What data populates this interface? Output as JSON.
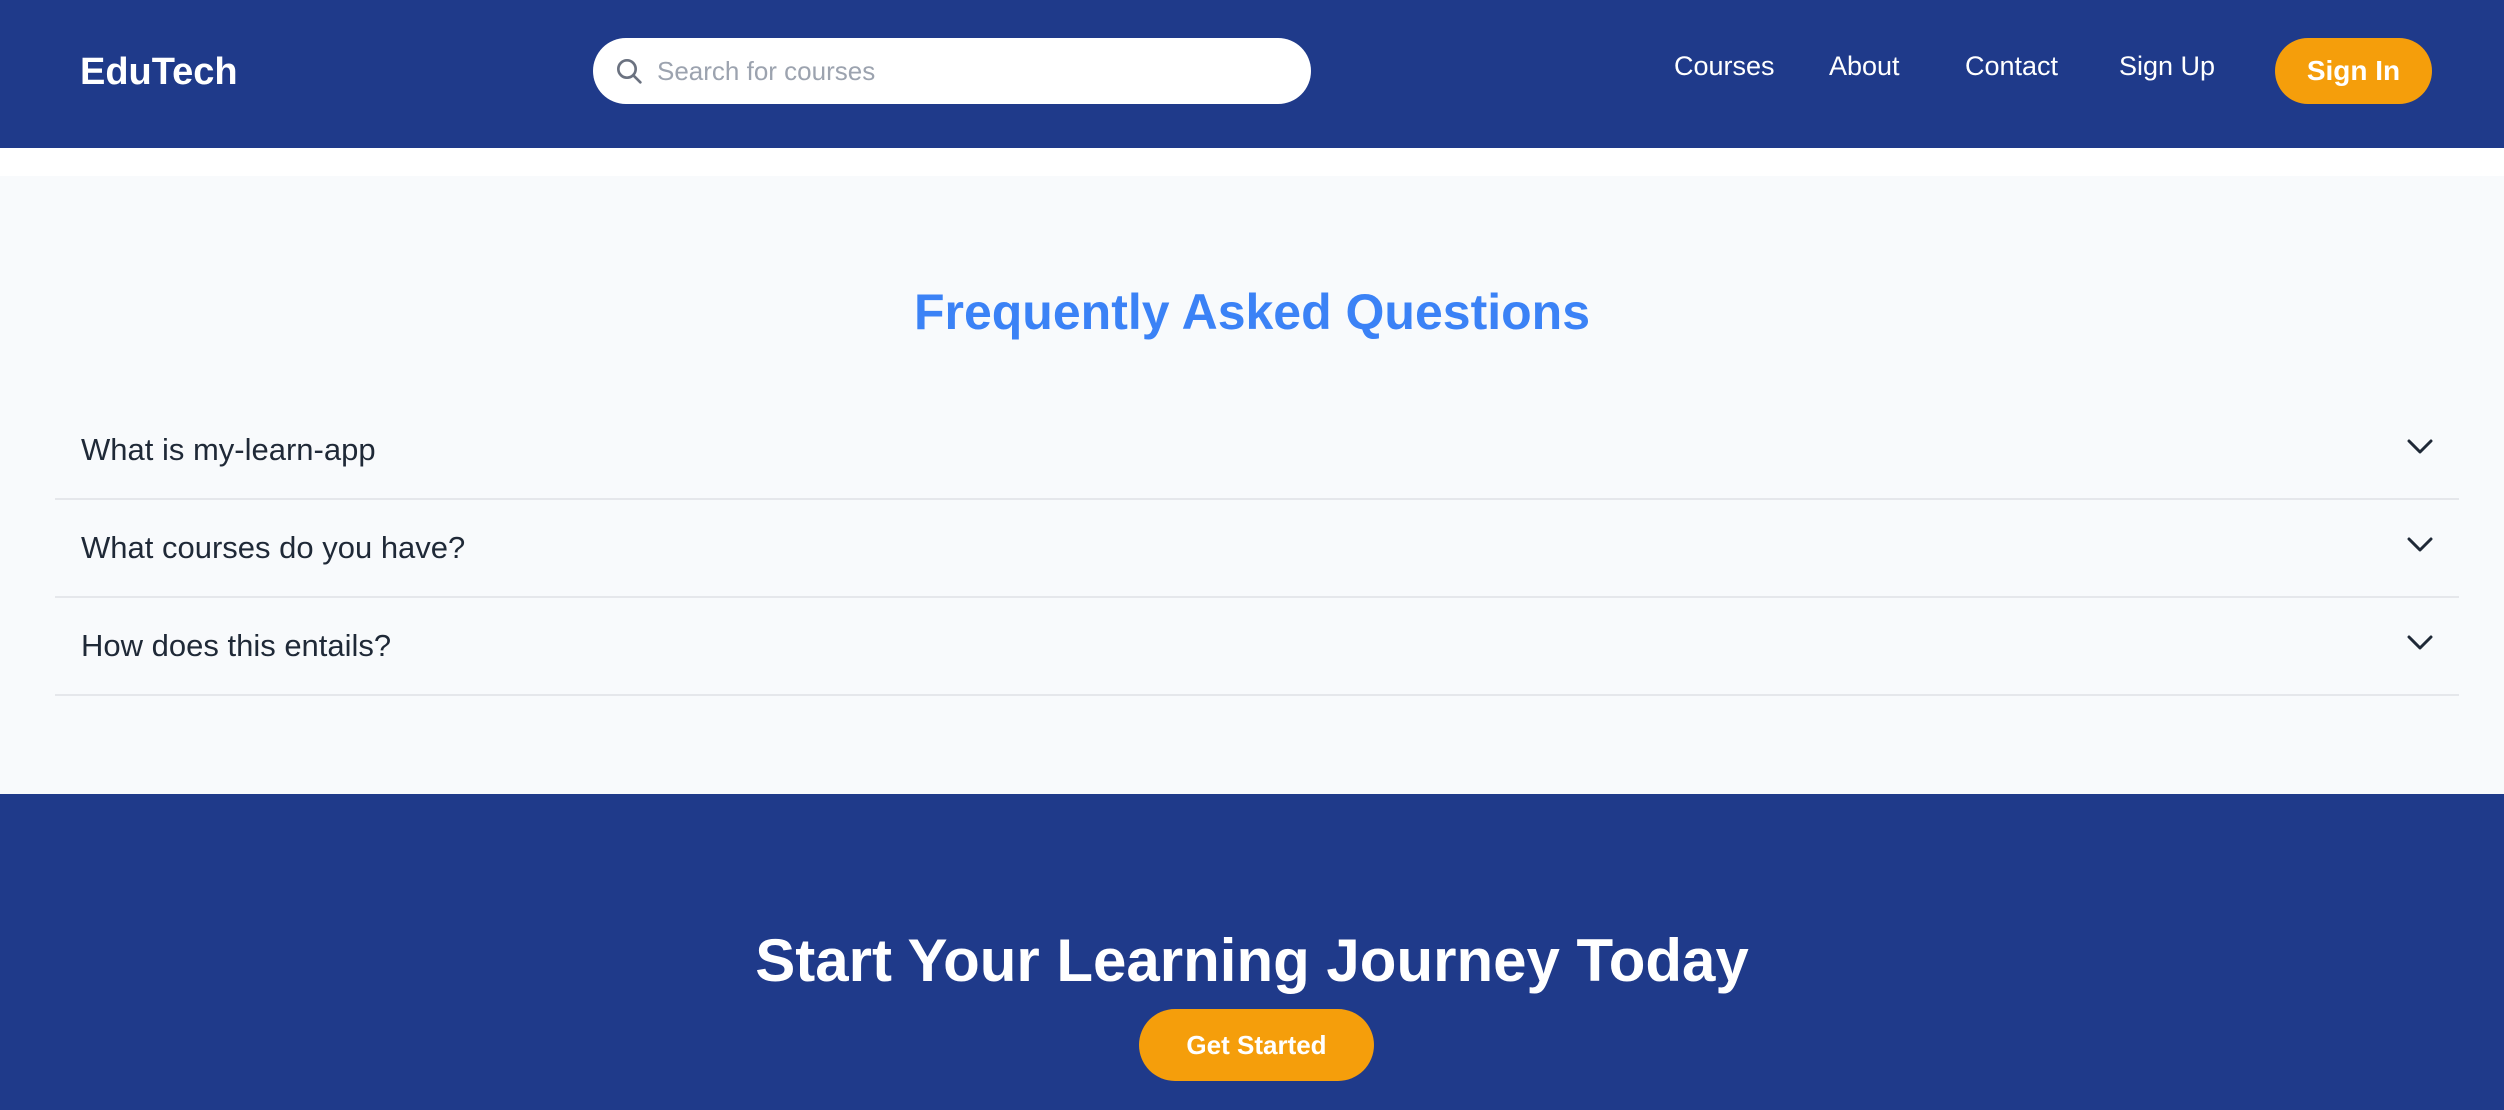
{
  "header": {
    "logo": "EduTech",
    "search": {
      "placeholder": "Search for courses",
      "value": ""
    },
    "nav": [
      {
        "label": "Courses"
      },
      {
        "label": "About"
      },
      {
        "label": "Contact"
      },
      {
        "label": "Sign Up"
      }
    ],
    "signin_label": "Sign In"
  },
  "faq": {
    "title": "Frequently Asked Questions",
    "items": [
      {
        "question": "What is my-learn-app",
        "expanded": false
      },
      {
        "question": "What courses do you have?",
        "expanded": false
      },
      {
        "question": "How does this entails?",
        "expanded": false
      }
    ]
  },
  "cta": {
    "title": "Start Your Learning Journey Today",
    "button_label": "Get Started"
  },
  "colors": {
    "header_bg": "#1f3a8a",
    "accent": "#f59e0b",
    "faq_title": "#3b82f6",
    "faq_bg": "#f8fafc"
  },
  "icons": {
    "search": "search-icon",
    "chevron": "chevron-down-icon"
  }
}
